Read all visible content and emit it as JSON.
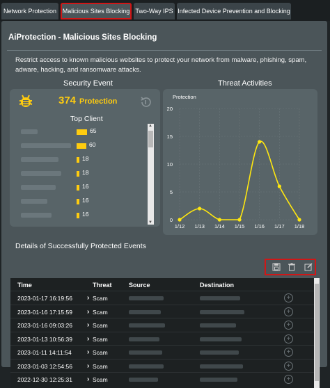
{
  "tabs": [
    {
      "label": "Network Protection"
    },
    {
      "label": "Malicious Sites Blocking"
    },
    {
      "label": "Two-Way IPS"
    },
    {
      "label": "Infected Device Prevention and Blocking"
    }
  ],
  "page": {
    "title": "AiProtection - Malicious Sites Blocking",
    "description": "Restrict access to known malicious websites to protect your network from malware, phishing, spam, adware, hacking, and ransomware attacks."
  },
  "security_event": {
    "heading": "Security Event",
    "count": "374",
    "count_label": "Protection",
    "top_client_heading": "Top Client",
    "clients": [
      {
        "count": "65",
        "value": 65
      },
      {
        "count": "60",
        "value": 60
      },
      {
        "count": "18",
        "value": 18
      },
      {
        "count": "18",
        "value": 18
      },
      {
        "count": "16",
        "value": 16
      },
      {
        "count": "16",
        "value": 16
      },
      {
        "count": "16",
        "value": 16
      }
    ]
  },
  "threat_activities": {
    "heading": "Threat Activities"
  },
  "chart_data": {
    "type": "line",
    "title": "",
    "legend": "Protection",
    "categories": [
      "1/12",
      "1/13",
      "1/14",
      "1/15",
      "1/16",
      "1/17",
      "1/18"
    ],
    "series": [
      {
        "name": "Protection",
        "values": [
          0,
          2,
          0,
          0,
          14,
          6,
          0
        ]
      }
    ],
    "ylim": [
      0,
      20
    ],
    "yticks": [
      "0",
      "5",
      "10",
      "15",
      "20"
    ],
    "grid": true,
    "color": "#ffe70f"
  },
  "details": {
    "heading": "Details of Successfully Protected Events",
    "tools": [
      {
        "icon": "save-icon"
      },
      {
        "icon": "trash-icon"
      },
      {
        "icon": "edit-icon"
      }
    ],
    "columns": {
      "time": "Time",
      "threat": "Threat",
      "source": "Source",
      "destination": "Destination"
    },
    "rows": [
      {
        "time": "2023-01-17 16:19:56",
        "threat": "Scam"
      },
      {
        "time": "2023-01-16 17:15:59",
        "threat": "Scam"
      },
      {
        "time": "2023-01-16 09:03:26",
        "threat": "Scam"
      },
      {
        "time": "2023-01-13 10:56:39",
        "threat": "Scam"
      },
      {
        "time": "2023-01-11 14:11:54",
        "threat": "Scam"
      },
      {
        "time": "2023-01-03 12:54:56",
        "threat": "Scam"
      },
      {
        "time": "2022-12-30 12:25:31",
        "threat": "Scam"
      }
    ]
  },
  "colors": {
    "accent": "#ffcc0f",
    "highlight": "#d01717"
  }
}
